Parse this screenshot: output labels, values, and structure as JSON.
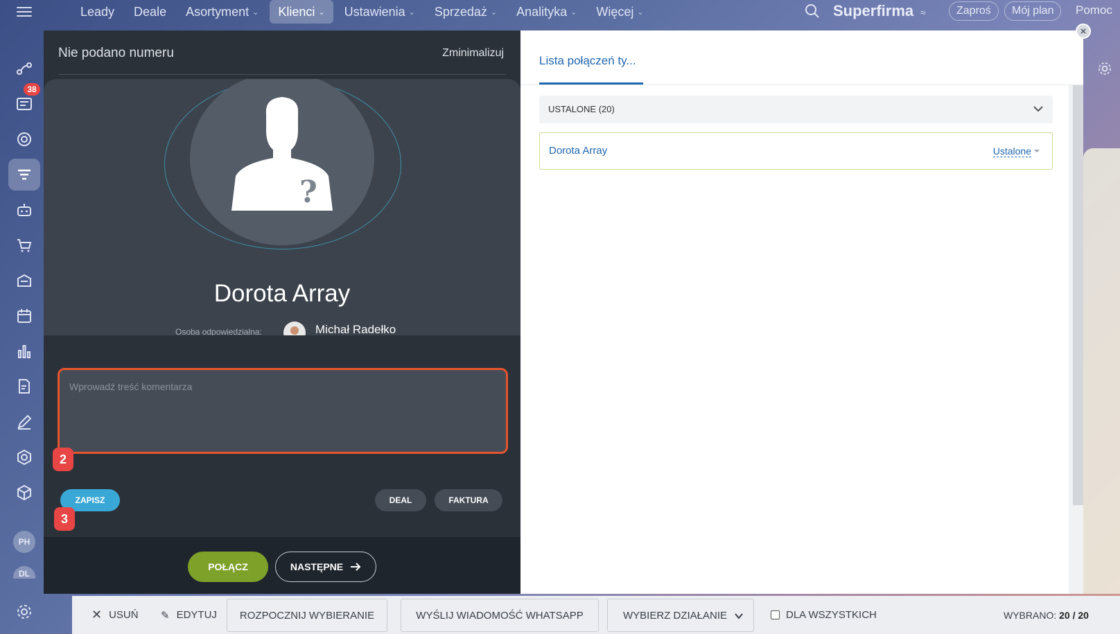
{
  "topnav": {
    "items": [
      {
        "label": "Leady",
        "dropdown": false,
        "active": false
      },
      {
        "label": "Deale",
        "dropdown": false,
        "active": false
      },
      {
        "label": "Asortyment",
        "dropdown": true,
        "active": false
      },
      {
        "label": "Klienci",
        "dropdown": true,
        "active": true
      },
      {
        "label": "Ustawienia",
        "dropdown": true,
        "active": false
      },
      {
        "label": "Sprzedaż",
        "dropdown": true,
        "active": false
      },
      {
        "label": "Analityka",
        "dropdown": true,
        "active": false
      },
      {
        "label": "Więcej",
        "dropdown": true,
        "active": false
      }
    ],
    "brand": "Superfirma",
    "invite": "Zaproś",
    "plan": "Mój plan",
    "help": "Pomoc"
  },
  "sidebar": {
    "badge_count": "38",
    "avatars": [
      "PH",
      "DL"
    ]
  },
  "call_panel": {
    "title": "Nie podano numeru",
    "minimize": "Zminimalizuj",
    "contact_name": "Dorota Array",
    "responsible_label": "Osoba odpowiedzialna:",
    "responsible_name": "Michał Radełko",
    "comment_placeholder": "Wprowadź treść komentarza",
    "save": "ZAPISZ",
    "deal": "DEAL",
    "invoice": "FAKTURA",
    "call": "POŁĄCZ",
    "next": "NASTĘPNE",
    "markers": [
      "2",
      "3"
    ]
  },
  "list_panel": {
    "tab": "Lista połączeń ty...",
    "group_title": "USTALONE (20)",
    "rows": [
      {
        "name": "Dorota Array",
        "status": "Ustalone"
      }
    ]
  },
  "bottombar": {
    "delete": "USUŃ",
    "edit": "EDYTUJ",
    "start_dialing": "ROZPOCZNIJ WYBIERANIE",
    "whatsapp": "WYŚLIJ WIADOMOŚĆ WHATSAPP",
    "choose_action": "WYBIERZ DZIAŁANIE",
    "for_all": "DLA WSZYSTKICH",
    "selected_label": "WYBRANO:",
    "selected_value": "20 / 20"
  },
  "colors": {
    "accent_blue": "#2067b0",
    "call_green": "#7ea12a",
    "save_blue": "#3aa8d6",
    "highlight_red": "#e5542d",
    "badge_red": "#e84545"
  }
}
